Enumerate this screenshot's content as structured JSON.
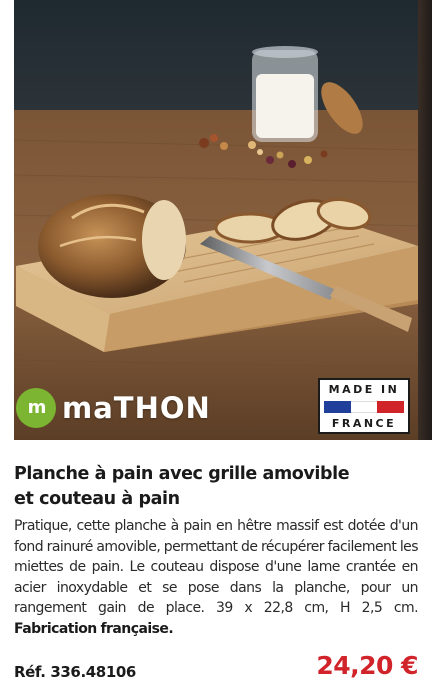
{
  "brand": {
    "name": "maTHON",
    "mark": "m",
    "mark_color": "#7cb531"
  },
  "badge": {
    "line1": "MADE IN",
    "line2": "FRANCE",
    "flag_colors": [
      "#1f3f9a",
      "#ffffff",
      "#d1242a"
    ]
  },
  "product": {
    "title_line1": "Planche à pain avec grille amovible",
    "title_line2": "et couteau à pain",
    "description": "Pratique, cette planche à pain en hêtre massif est dotée d'un fond rainuré amovible, permettant de récupérer facilement les miettes de pain. Le couteau dispose d'une lame crantée en acier inoxydable et se pose dans la planche, pour un rangement gain de place. 39 x 22,8 cm, H 2,5 cm.",
    "description_emphasis": "Fabrication française.",
    "reference": "Réf. 336.48106",
    "price": "24,20 €",
    "price_color": "#d1242a"
  }
}
